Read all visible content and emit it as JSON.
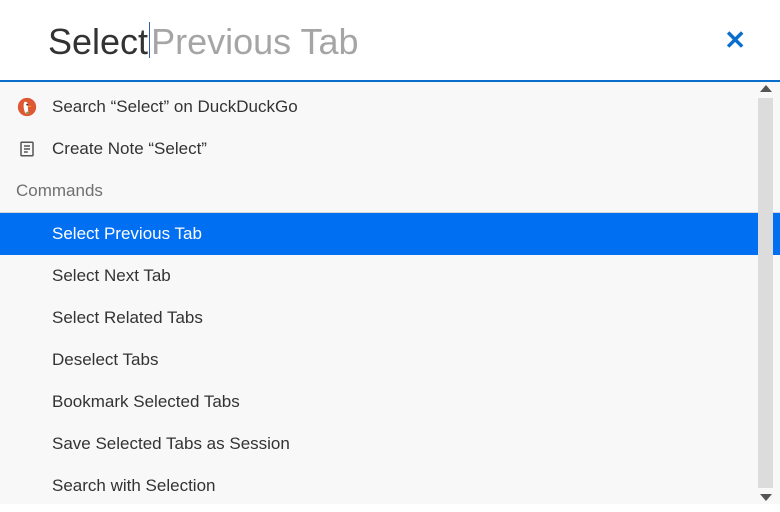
{
  "colors": {
    "accent": "#0a6ecc",
    "selection": "#006ff1"
  },
  "search": {
    "typed": "Select",
    "suggestion_rest": " Previous Tab"
  },
  "close_label": "✕",
  "quick_actions": [
    {
      "id": "search-ddg",
      "icon": "duckduckgo-icon",
      "label": "Search “Select” on DuckDuckGo"
    },
    {
      "id": "create-note",
      "icon": "note-icon",
      "label": "Create Note “Select”"
    }
  ],
  "sections": [
    {
      "title": "Commands",
      "items": [
        {
          "id": "select-previous-tab",
          "label": "Select Previous Tab",
          "selected": true
        },
        {
          "id": "select-next-tab",
          "label": "Select Next Tab"
        },
        {
          "id": "select-related-tabs",
          "label": "Select Related Tabs"
        },
        {
          "id": "deselect-tabs",
          "label": "Deselect Tabs"
        },
        {
          "id": "bookmark-selected-tabs",
          "label": "Bookmark Selected Tabs"
        },
        {
          "id": "save-selected-tabs-as-session",
          "label": "Save Selected Tabs as Session"
        },
        {
          "id": "search-with-selection",
          "label": "Search with Selection"
        }
      ]
    }
  ]
}
